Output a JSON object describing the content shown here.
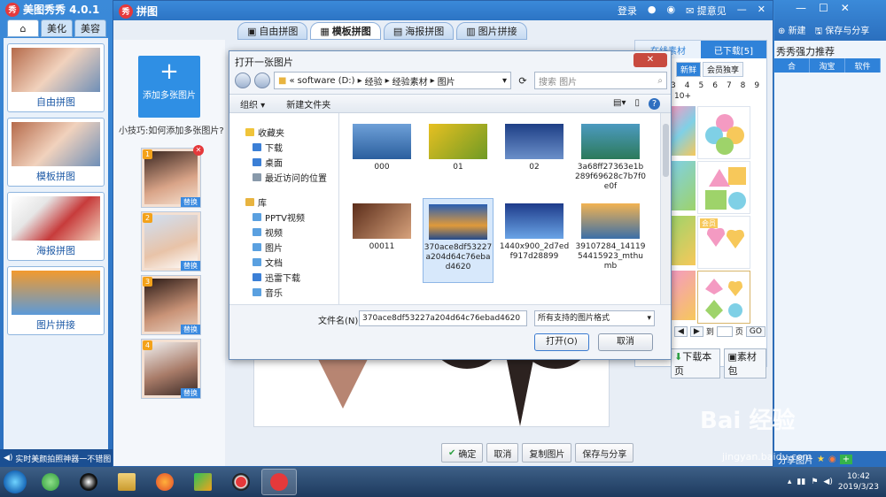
{
  "app": {
    "title": "美图秀秀 4.0.1",
    "tabs": [
      "美化",
      "美容"
    ],
    "templates": [
      "自由拼图",
      "模板拼图",
      "海报拼图",
      "图片拼接"
    ],
    "status": "实时美颜拍照神器一不错图"
  },
  "collage": {
    "title": "拼图",
    "actions": [
      "登录",
      "提意见"
    ],
    "tabs": [
      "自由拼图",
      "模板拼图",
      "海报拼图",
      "图片拼接"
    ],
    "add_label": "添加多张图片",
    "tip": "小技巧:如何添加多张图片?",
    "slot_replace": "替换",
    "slot_nums": [
      "1",
      "2",
      "3",
      "4"
    ],
    "bottom": [
      "确定",
      "取消",
      "复制图片",
      "保存与分享"
    ]
  },
  "right_panel": {
    "tabs": [
      "在线素材",
      "已下载[5]"
    ],
    "sub": [
      "新鲜",
      "会员独享"
    ],
    "pages": [
      "3",
      "4",
      "5",
      "6",
      "7",
      "8",
      "9"
    ],
    "page10": "10+",
    "pager_prefix": "到",
    "pager_suffix": "页",
    "go": "GO",
    "download_page": "下载本页",
    "material_pack": "素材包",
    "vip": "会员"
  },
  "right_strip": {
    "new": "新建",
    "save": "保存与分享",
    "title": "秀秀强力推荐",
    "tabs": [
      "合",
      "淘宝",
      "软件"
    ],
    "share": "分享图片"
  },
  "dialog": {
    "title": "打开一张图片",
    "address": [
      "software (D:)",
      "经验",
      "经验素材",
      "图片"
    ],
    "search_placeholder": "搜索 图片",
    "toolbar": [
      "组织 ▾",
      "新建文件夹"
    ],
    "tree": [
      {
        "label": "收藏夹",
        "color": "#f0c43a"
      },
      {
        "label": "下载",
        "color": "#3b7fd6"
      },
      {
        "label": "桌面",
        "color": "#3b7fd6"
      },
      {
        "label": "最近访问的位置",
        "color": "#8899aa"
      },
      {
        "label": "库",
        "color": "#e8b440"
      },
      {
        "label": "PPTV视频",
        "color": "#5aa0e0"
      },
      {
        "label": "视频",
        "color": "#5aa0e0"
      },
      {
        "label": "图片",
        "color": "#5aa0e0"
      },
      {
        "label": "文档",
        "color": "#5aa0e0"
      },
      {
        "label": "迅雷下载",
        "color": "#3b7fd6"
      },
      {
        "label": "音乐",
        "color": "#5aa0e0"
      }
    ],
    "files": [
      {
        "name": "000",
        "bg": "linear-gradient(#6ea0d8,#2b5f9e)"
      },
      {
        "name": "01",
        "bg": "linear-gradient(135deg,#e7c021,#6f9a24)"
      },
      {
        "name": "02",
        "bg": "linear-gradient(#1e3f86,#6b8fc9)"
      },
      {
        "name": "3a68ff27363e1b289f69628c7b7f0e0f",
        "bg": "linear-gradient(#4c9ac0,#2c7a5a)"
      },
      {
        "name": "00011",
        "bg": "linear-gradient(135deg,#5b2d1a,#d7a27c)"
      },
      {
        "name": "370ace8df53227a204d64c76ebad4620",
        "bg": "linear-gradient(#2a5fb3,#e09a3a 60%,#234b8c)"
      },
      {
        "name": "1440x900_2d7edf917d28899",
        "bg": "linear-gradient(#1e3b8a,#6aa4e6)"
      },
      {
        "name": "39107284_1411954415923_mthumb",
        "bg": "linear-gradient(#f2b352,#3b6fa8)"
      }
    ],
    "filename_label": "文件名(N):",
    "filename": "370ace8df53227a204d64c76ebad4620",
    "filetype": "所有支持的图片格式",
    "open": "打开(O)",
    "cancel": "取消"
  },
  "tray": {
    "time": "10:42",
    "date": "2019/3/23"
  },
  "watermark": "Bai 经验",
  "watermark_url": "jingyan.baidu.com"
}
